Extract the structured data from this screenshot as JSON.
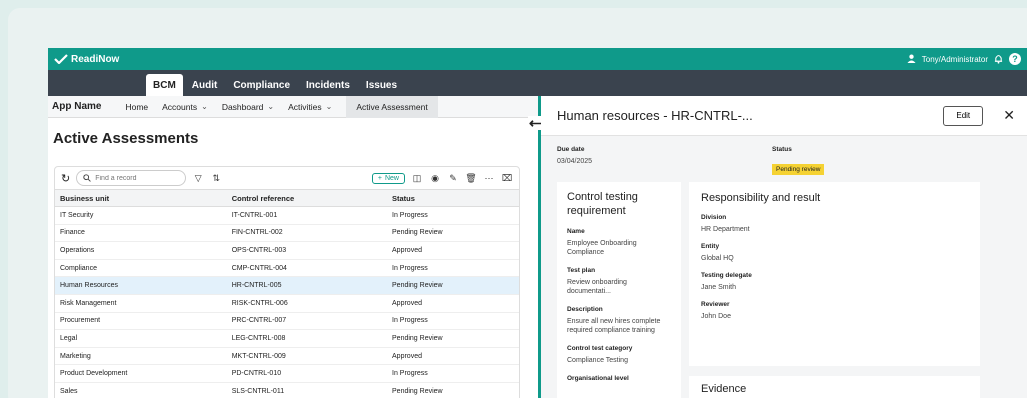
{
  "app": {
    "logo": "ReadiNow",
    "user": "Tony/Administrator",
    "help": "?"
  },
  "nav": {
    "tabs": [
      "BCM",
      "Audit",
      "Compliance",
      "Incidents",
      "Issues"
    ]
  },
  "subnav": {
    "app_name": "App Name",
    "items": [
      "Home",
      "Accounts",
      "Dashboard",
      "Activities",
      "Active Assessment"
    ]
  },
  "page": {
    "title": "Active Assessments"
  },
  "toolbar": {
    "search_placeholder": "Find a record",
    "new_label": "New"
  },
  "table": {
    "headers": [
      "Business unit",
      "Control reference",
      "Status"
    ],
    "rows": [
      [
        "IT Security",
        "IT-CNTRL-001",
        "In Progress"
      ],
      [
        "Finance",
        "FIN-CNTRL-002",
        "Pending Review"
      ],
      [
        "Operations",
        "OPS-CNTRL-003",
        "Approved"
      ],
      [
        "Compliance",
        "CMP-CNTRL-004",
        "In Progress"
      ],
      [
        "Human Resources",
        "HR-CNTRL-005",
        "Pending Review"
      ],
      [
        "Risk Management",
        "RISK-CNTRL-006",
        "Approved"
      ],
      [
        "Procurement",
        "PRC-CNTRL-007",
        "In Progress"
      ],
      [
        "Legal",
        "LEG-CNTRL-008",
        "Pending Review"
      ],
      [
        "Marketing",
        "MKT-CNTRL-009",
        "Approved"
      ],
      [
        "Product Development",
        "PD-CNTRL-010",
        "In Progress"
      ],
      [
        "Sales",
        "SLS-CNTRL-011",
        "Pending Review"
      ]
    ],
    "selected_index": 4
  },
  "detail": {
    "title": "Human resources - HR-CNTRL-...",
    "edit_label": "Edit",
    "due_date_label": "Due date",
    "due_date": "03/04/2025",
    "status_label": "Status",
    "status": "Pending review",
    "ctr": {
      "title": "Control testing requirement",
      "name_label": "Name",
      "name": "Employee Onboarding Compliance",
      "test_plan_label": "Test plan",
      "test_plan": "Review onboarding documentati...",
      "description_label": "Description",
      "description": "Ensure all new hires complete required compliance training",
      "category_label": "Control test category",
      "category": "Compliance Testing",
      "org_level_label": "Organisational level"
    },
    "rr": {
      "title": "Responsibility and result",
      "division_label": "Division",
      "division": "HR Department",
      "entity_label": "Entity",
      "entity": "Global HQ",
      "delegate_label": "Testing delegate",
      "delegate": "Jane Smith",
      "reviewer_label": "Reviewer",
      "reviewer": "John Doe"
    },
    "evidence_title": "Evidence"
  },
  "colors": {
    "brand": "#0f9a8a",
    "navbar": "#3a434e",
    "badge": "#f5d233",
    "selected_row": "#e3f1fb"
  }
}
